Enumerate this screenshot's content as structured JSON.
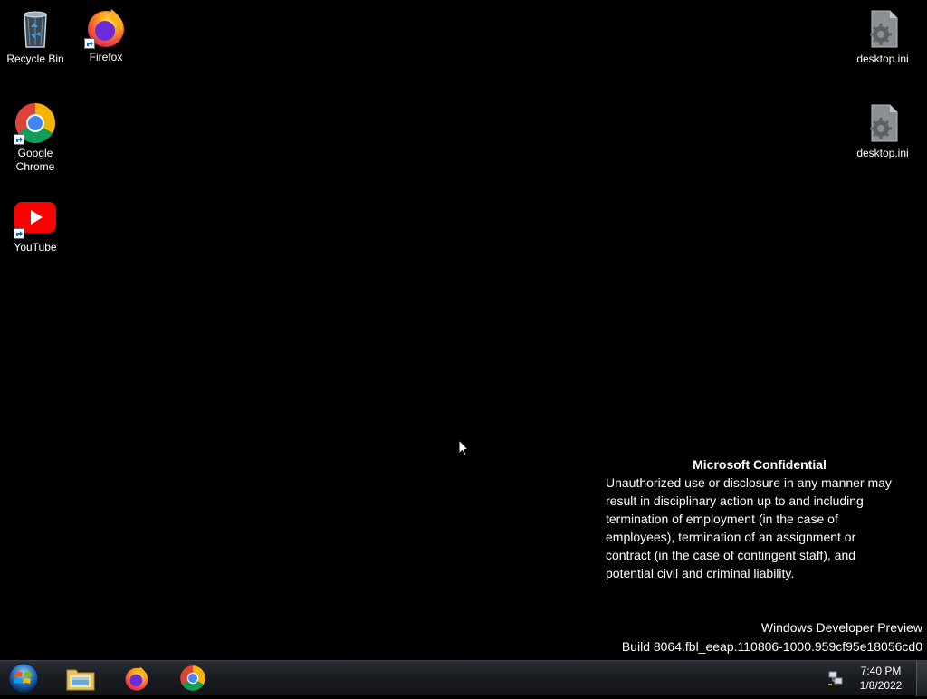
{
  "desktop": {
    "icons": [
      {
        "label": "Recycle Bin",
        "icon": "recycle-bin-icon"
      },
      {
        "label": "Firefox",
        "icon": "firefox-icon"
      },
      {
        "label": "Google Chrome",
        "icon": "chrome-icon"
      },
      {
        "label": "YouTube",
        "icon": "youtube-icon"
      },
      {
        "label": "desktop.ini",
        "icon": "settings-file-icon"
      },
      {
        "label": "desktop.ini",
        "icon": "settings-file-icon"
      }
    ]
  },
  "watermark": {
    "title": "Microsoft Confidential",
    "lines": [
      "Unauthorized use or disclosure in any manner may",
      "result in disciplinary action up to and including",
      "termination of employment (in the case of",
      "employees), termination of an assignment or",
      "contract (in the case of contingent staff), and",
      "potential civil and criminal liability."
    ],
    "edition": "Windows Developer Preview",
    "build": "Build 8064.fbl_eeap.110806-1000.959cf95e18056cd0"
  },
  "taskbar": {
    "start_icon": "windows-logo-icon",
    "pinned": [
      "file-explorer-icon",
      "firefox-icon",
      "chrome-icon"
    ],
    "tray": {
      "network_icon": "network-icon"
    },
    "clock": {
      "time": "7:40 PM",
      "date": "1/8/2022"
    }
  },
  "colors": {
    "desktop_bg": "#000000",
    "taskbar_bg": "#1a1d22"
  }
}
